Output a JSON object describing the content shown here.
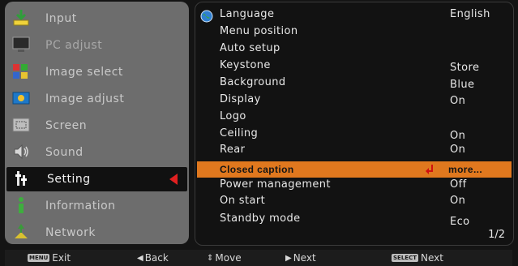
{
  "main_menu": [
    {
      "label": "Input",
      "icon": "input-icon"
    },
    {
      "label": "PC adjust",
      "icon": "pc-adjust-icon"
    },
    {
      "label": "Image select",
      "icon": "image-select-icon"
    },
    {
      "label": "Image adjust",
      "icon": "image-adjust-icon"
    },
    {
      "label": "Screen",
      "icon": "screen-icon"
    },
    {
      "label": "Sound",
      "icon": "sound-icon"
    },
    {
      "label": "Setting",
      "icon": "setting-icon",
      "selected": true
    },
    {
      "label": "Information",
      "icon": "information-icon"
    },
    {
      "label": "Network",
      "icon": "network-icon"
    }
  ],
  "settings_rows": [
    {
      "name": "Language",
      "value": "English"
    },
    {
      "name": "Menu position",
      "value": ""
    },
    {
      "name": "Auto setup",
      "value": ""
    },
    {
      "name": "Keystone",
      "value": "Store"
    },
    {
      "name": "Background",
      "value": "Blue"
    },
    {
      "name": "Display",
      "value": "On"
    },
    {
      "name": "Logo",
      "value": ""
    },
    {
      "name": "Ceiling",
      "value": "On"
    },
    {
      "name": "Rear",
      "value": "On"
    },
    {
      "name": "Closed caption",
      "value": "more..."
    },
    {
      "name": "Power management",
      "value": "Off"
    },
    {
      "name": "On start",
      "value": "On"
    },
    {
      "name": "Standby mode",
      "value": "Eco"
    }
  ],
  "page_indicator": "1/2",
  "bottom_bar": {
    "menu_key": "MENU",
    "exit_label": "Exit",
    "back_label": "Back",
    "move_label": "Move",
    "next_label": "Next",
    "select_key": "SELECT",
    "select_next_label": "Next"
  },
  "colors": {
    "highlight": "#e0781e",
    "selected_arrow": "#e02020",
    "left_panel": "#6d6d6d",
    "right_panel": "#121212"
  }
}
